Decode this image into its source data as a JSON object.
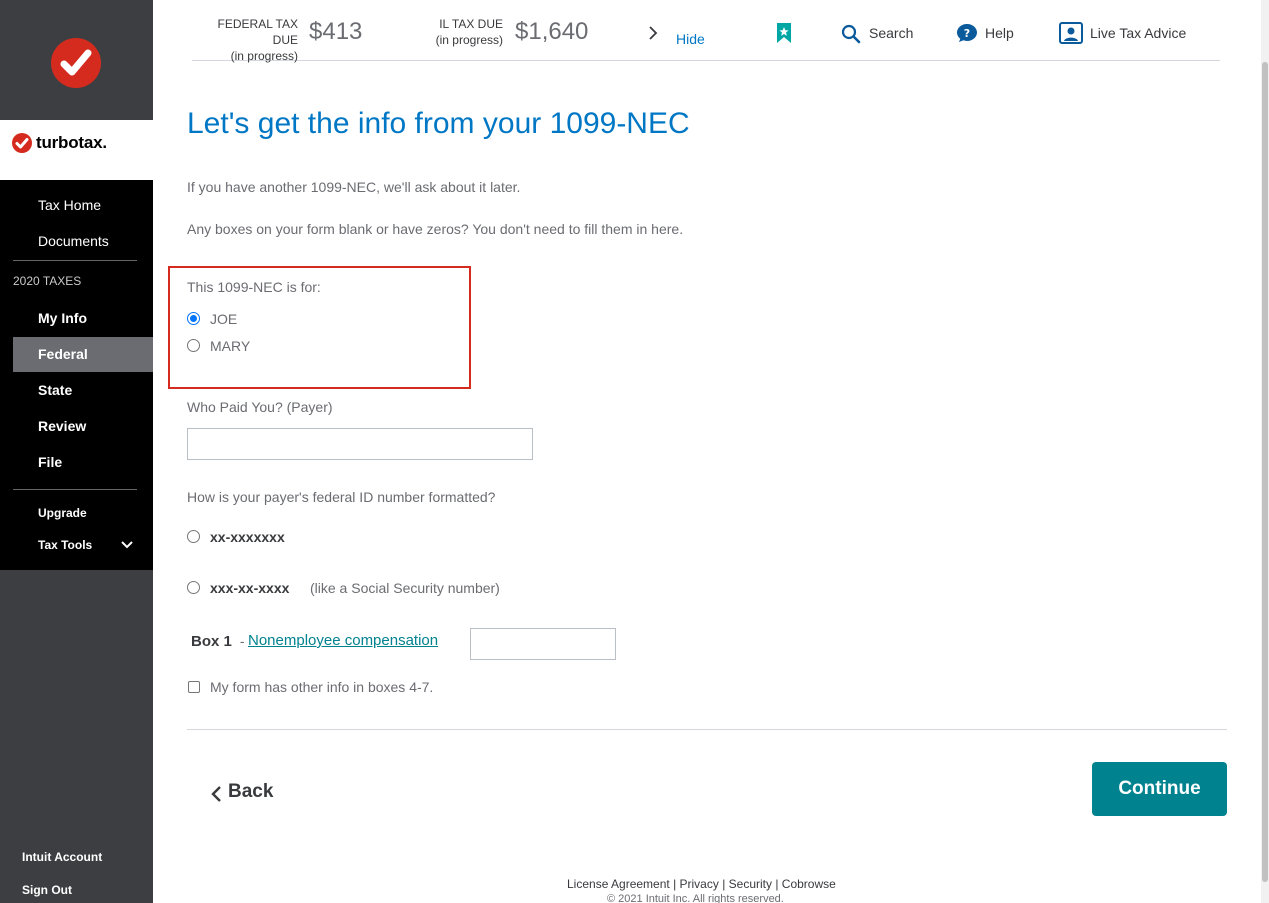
{
  "sidebar": {
    "brand": "turbotax.",
    "items": [
      {
        "label": "Tax Home"
      },
      {
        "label": "Documents"
      }
    ],
    "section_label": "2020 TAXES",
    "tax_items": [
      {
        "label": "My Info"
      },
      {
        "label": "Federal"
      },
      {
        "label": "State"
      },
      {
        "label": "Review"
      },
      {
        "label": "File"
      }
    ],
    "upgrade": "Upgrade",
    "tax_tools": "Tax Tools",
    "intuit_account": "Intuit Account",
    "sign_out": "Sign Out"
  },
  "header": {
    "federal_label": "FEDERAL TAX DUE",
    "federal_sub": "(in progress)",
    "federal_amount": "$413",
    "il_label": "IL TAX DUE",
    "il_sub": "(in progress)",
    "il_amount": "$1,640",
    "hide": "Hide",
    "search": "Search",
    "help": "Help",
    "live_advice": "Live Tax Advice"
  },
  "main": {
    "title": "Let's get the info from your 1099-NEC",
    "para1": "If you have another 1099-NEC, we'll ask about it later.",
    "para2": "Any boxes on your form blank or have zeros? You don't need to fill them in here.",
    "for_label": "This 1099-NEC is for:",
    "option_joe": "JOE",
    "option_mary": "MARY",
    "payer_label": "Who Paid You? (Payer)",
    "payer_value": "",
    "id_format_label": "How is your payer's federal ID number formatted?",
    "id_option1": "xx-xxxxxxx",
    "id_option2": "xxx-xx-xxxx",
    "id_option2_note": "(like a Social Security number)",
    "box1_label": "Box 1",
    "box1_sep": " - ",
    "box1_link": "Nonemployee compensation",
    "box1_value": "",
    "other_info": "My form has other info in boxes 4-7.",
    "back": "Back",
    "continue": "Continue"
  },
  "footer": {
    "links": "License Agreement | Privacy | Security | Cobrowse",
    "copyright": "© 2021 Intuit Inc. All rights reserved."
  },
  "colors": {
    "accent_blue": "#0077c5",
    "teal": "#00828f",
    "brand_red": "#d52b1e",
    "highlight_red": "#d52b1e"
  }
}
